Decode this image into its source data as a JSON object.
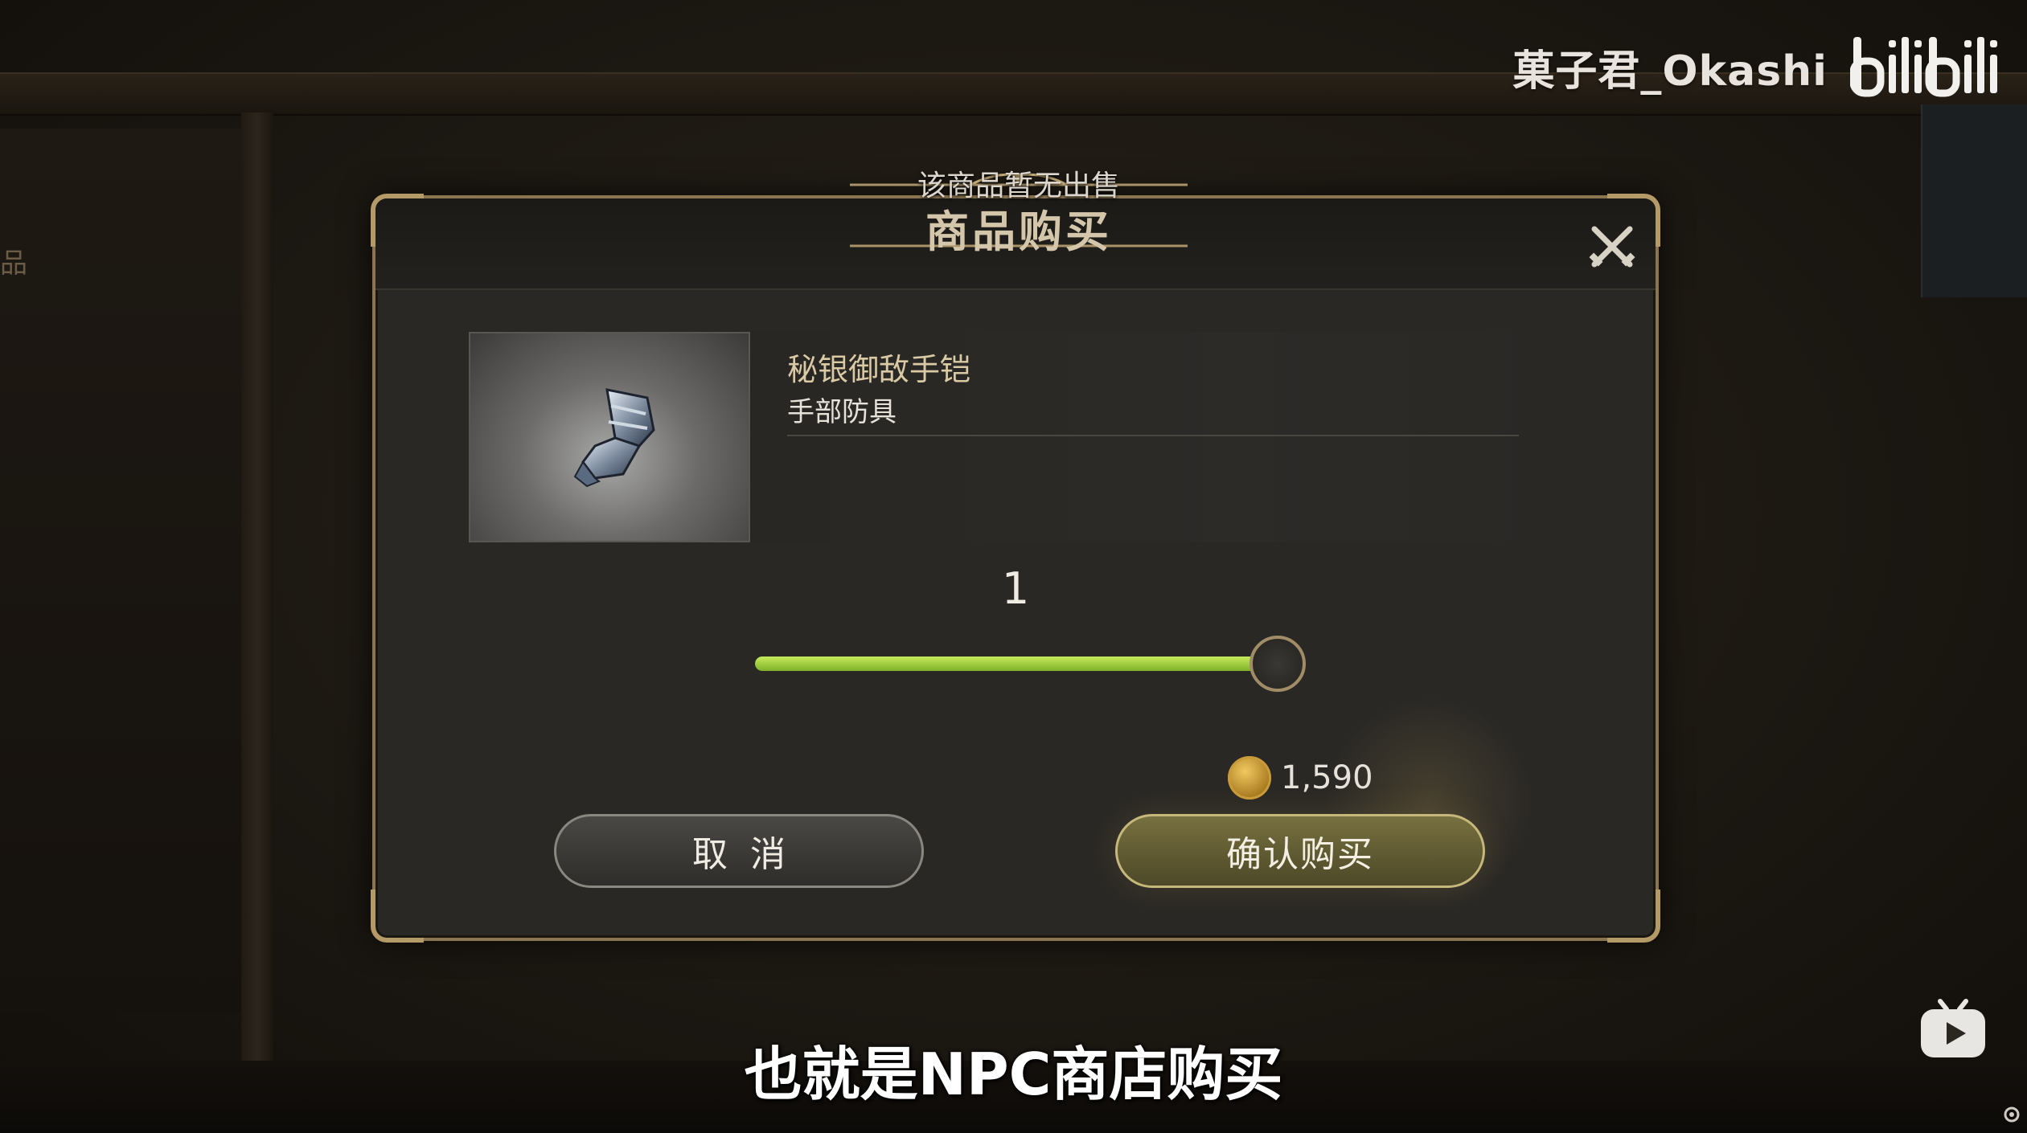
{
  "watermark": {
    "user": "菓子君_Okashi",
    "logo": "bilibili"
  },
  "background": {
    "left_text": "品"
  },
  "dialog": {
    "title": "商品购买",
    "toast": "该商品暂无出售",
    "close_icon": "close-crossed-swords-icon"
  },
  "item": {
    "name": "秘银御敌手铠",
    "type": "手部防具",
    "icon": "gauntlet-icon"
  },
  "quantity": {
    "value": "1",
    "slider_fraction": 1.0
  },
  "price": {
    "currency_icon": "gold-coin-icon",
    "amount": "1,590"
  },
  "buttons": {
    "cancel": "取消",
    "confirm": "确认购买"
  },
  "subtitle": "也就是NPC商店购买",
  "colors": {
    "slider_fill": "#a6d43e",
    "frame_gold": "#b39a66",
    "confirm_bg": "#6a6438"
  }
}
